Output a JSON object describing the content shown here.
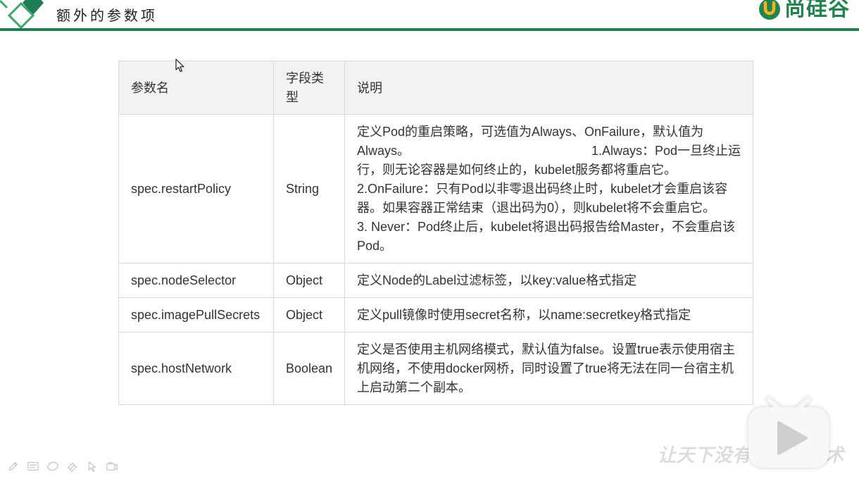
{
  "theme": {
    "accent": "#1e7e53",
    "brand": "#22844f",
    "brand_icon_inner": "#f5b21c",
    "header_row_bg": "#f2f2f2",
    "table_border": "#d9d9d9",
    "text": "#333333",
    "watermark": "#dcdcdc",
    "toolbar_icon": "#c9c9c9"
  },
  "header": {
    "logo_icon": "diamond-logo-icon",
    "title": "额外的参数项",
    "brand_icon": "brand-u-icon",
    "brand_name": "尚硅谷"
  },
  "table": {
    "headers": [
      "参数名",
      "字段类型",
      "说明"
    ],
    "rows": [
      {
        "name": "spec.restartPolicy",
        "type": "String",
        "description_lines": [
          [
            "定义Pod的重启策略，可选值为Always、OnFailure，默认值为"
          ],
          [
            "Always。",
            "1.Always：Pod一旦终止运"
          ],
          [
            "行，则无论容器是如何终止的，kubelet服务都将重启它。"
          ],
          [
            "2.OnFailure：只有Pod以非零退出码终止时，kubelet才会重启该容"
          ],
          [
            "器。如果容器正常结束（退出码为0），则kubelet将不会重启它。"
          ],
          [
            "3. Never：Pod终止后，kubelet将退出码报告给Master，不会重启该"
          ],
          [
            "Pod。"
          ]
        ]
      },
      {
        "name": "spec.nodeSelector",
        "type": "Object",
        "description_lines": [
          [
            "定义Node的Label过滤标签，以key:value格式指定"
          ]
        ]
      },
      {
        "name": "spec.imagePullSecrets",
        "type": "Object",
        "description_lines": [
          [
            "定义pull镜像时使用secret名称，以name:secretkey格式指定"
          ]
        ]
      },
      {
        "name": "spec.hostNetwork",
        "type": "Boolean",
        "description_lines": [
          [
            "定义是否使用主机网络模式，默认值为false。设置true表示使用宿主"
          ],
          [
            "机网络，不使用docker网桥，同时设置了true将无法在同一台宿主机"
          ],
          [
            "上启动第二个副本。"
          ]
        ]
      }
    ]
  },
  "watermark": "让天下没有难学的技术",
  "toolbar": {
    "tools": [
      "pencil-icon",
      "board-icon",
      "ellipse-icon",
      "eraser-icon",
      "pointer-icon",
      "camera-icon"
    ]
  },
  "player": {
    "play_icon": "play-icon"
  },
  "cursor": {
    "icon": "arrow-cursor-icon"
  }
}
